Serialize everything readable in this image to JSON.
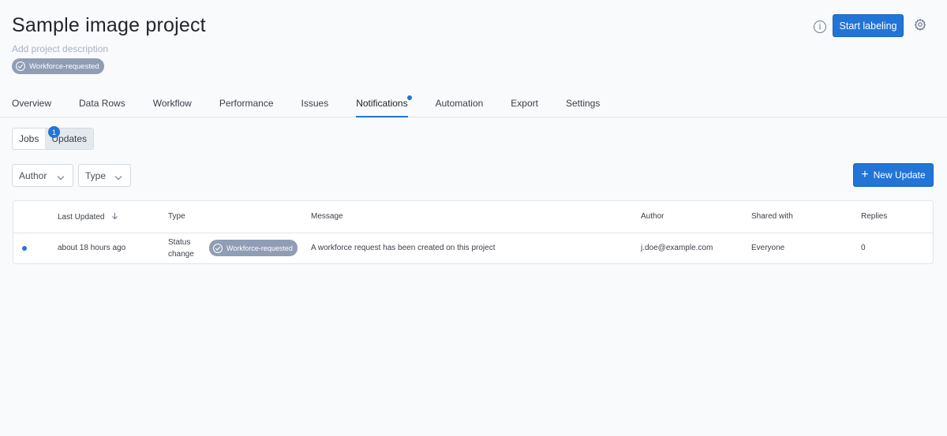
{
  "header": {
    "title": "Sample image project",
    "description_placeholder": "Add project description",
    "status_badge": "Workforce-requested",
    "start_button": "Start labeling"
  },
  "tabs": [
    {
      "label": "Overview"
    },
    {
      "label": "Data Rows"
    },
    {
      "label": "Workflow"
    },
    {
      "label": "Performance"
    },
    {
      "label": "Issues"
    },
    {
      "label": "Notifications",
      "active": true
    },
    {
      "label": "Automation"
    },
    {
      "label": "Export"
    },
    {
      "label": "Settings"
    }
  ],
  "segment": {
    "jobs": "Jobs",
    "updates": "Updates",
    "updates_count": "1"
  },
  "filters": {
    "author": "Author",
    "type": "Type"
  },
  "new_update_button": "New Update",
  "table": {
    "columns": [
      "Last Updated",
      "Type",
      "Message",
      "Author",
      "Shared with",
      "Replies"
    ],
    "rows": [
      {
        "last_updated": "about 18 hours ago",
        "type_line1": "Status",
        "type_line2": "change",
        "badge": "Workforce-requested",
        "message": "A workforce request has been created on this project",
        "author": "j.doe@example.com",
        "shared_with": "Everyone",
        "replies": "0"
      }
    ]
  },
  "colors": {
    "accent": "#2275d7",
    "badge_bg": "#8f9db5"
  }
}
